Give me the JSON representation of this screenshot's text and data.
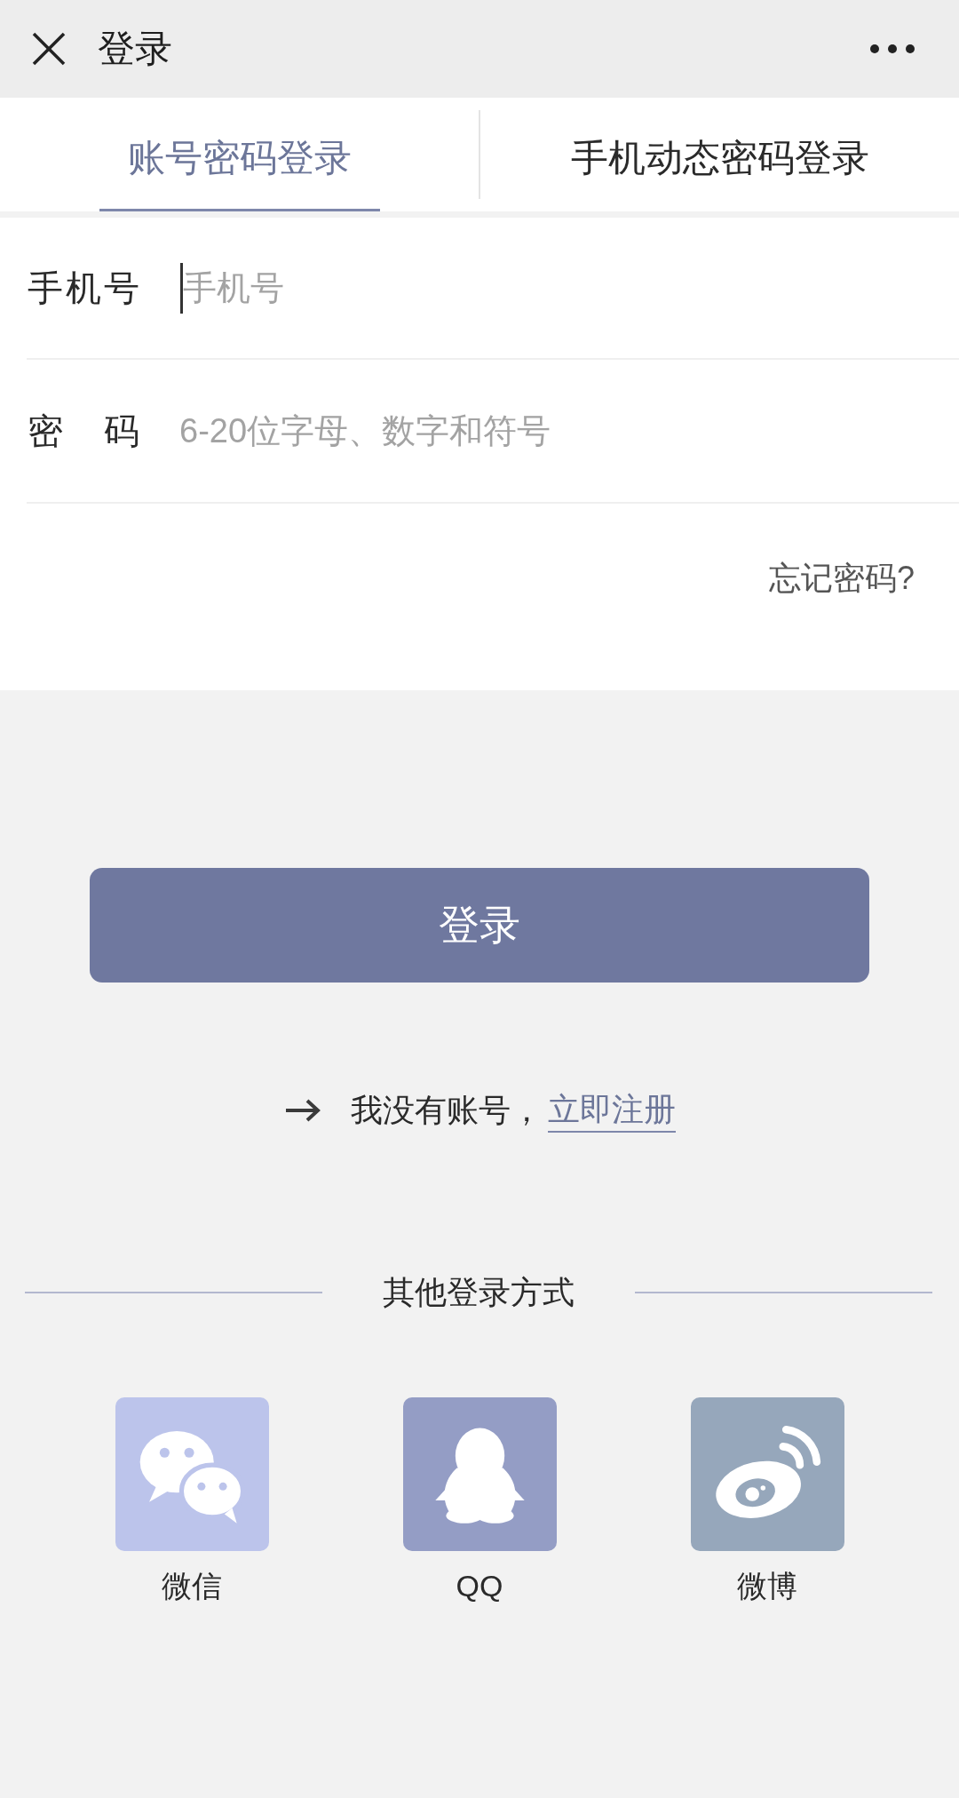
{
  "top_bar": {
    "title": "登录"
  },
  "tabs": [
    {
      "label": "账号密码登录",
      "selected": true
    },
    {
      "label": "手机动态密码登录",
      "selected": false
    }
  ],
  "form": {
    "fields": [
      {
        "label": "手机号",
        "placeholder": "手机号",
        "focused": true
      },
      {
        "label": "密 码",
        "placeholder": "6-20位字母、数字和符号",
        "focused": false
      }
    ],
    "forgot_password": "忘记密码?"
  },
  "login_button": "登录",
  "register": {
    "prompt": "我没有账号，",
    "link": "立即注册"
  },
  "other_login": {
    "title": "其他登录方式",
    "options": [
      {
        "kind": "wechat",
        "label": "微信",
        "color": "#bcc4eb"
      },
      {
        "kind": "qq",
        "label": "QQ",
        "color": "#949dc5"
      },
      {
        "kind": "weibo",
        "label": "微博",
        "color": "#96a7bb"
      }
    ]
  }
}
